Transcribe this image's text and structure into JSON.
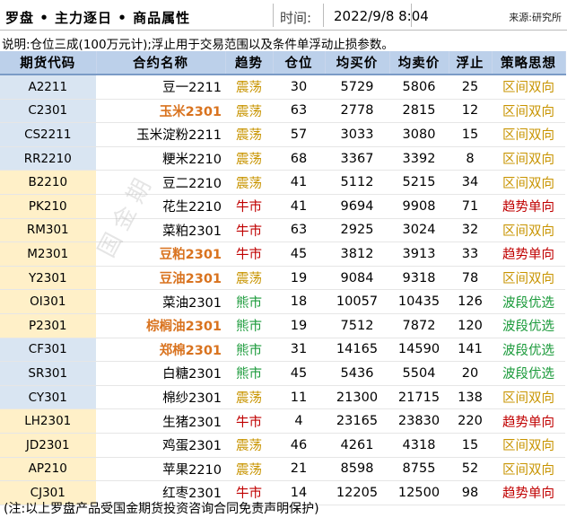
{
  "header": {
    "title": "罗盘 • 主力逐日 • 商品属性",
    "time_label": "时间:",
    "time_value": "2022/9/8 8:04",
    "source": "来源:研究所"
  },
  "note": "说明:仓位三成(100万元计);浮止用于交易范围以及条件单浮动止损参数。",
  "columns": [
    "期货代码",
    "合约名称",
    "趋势",
    "仓位",
    "均买价",
    "均卖价",
    "浮止",
    "策略思想"
  ],
  "rows": [
    {
      "code": "A2211",
      "name": "豆一2211",
      "trend": "震荡",
      "position": "30",
      "buy": "5729",
      "sell": "5806",
      "stop": "25",
      "strategy": "区间双向"
    },
    {
      "code": "C2301",
      "name": "玉米2301",
      "trend": "震荡",
      "position": "63",
      "buy": "2778",
      "sell": "2815",
      "stop": "12",
      "strategy": "区间双向"
    },
    {
      "code": "CS2211",
      "name": "玉米淀粉2211",
      "trend": "震荡",
      "position": "57",
      "buy": "3033",
      "sell": "3080",
      "stop": "15",
      "strategy": "区间双向"
    },
    {
      "code": "RR2210",
      "name": "粳米2210",
      "trend": "震荡",
      "position": "68",
      "buy": "3367",
      "sell": "3392",
      "stop": "8",
      "strategy": "区间双向"
    },
    {
      "code": "B2210",
      "name": "豆二2210",
      "trend": "震荡",
      "position": "41",
      "buy": "5112",
      "sell": "5215",
      "stop": "34",
      "strategy": "区间双向"
    },
    {
      "code": "PK210",
      "name": "花生2210",
      "trend": "牛市",
      "position": "41",
      "buy": "9694",
      "sell": "9908",
      "stop": "71",
      "strategy": "趋势单向"
    },
    {
      "code": "RM301",
      "name": "菜粕2301",
      "trend": "牛市",
      "position": "63",
      "buy": "2925",
      "sell": "3024",
      "stop": "32",
      "strategy": "区间双向"
    },
    {
      "code": "M2301",
      "name": "豆粕2301",
      "trend": "牛市",
      "position": "45",
      "buy": "3812",
      "sell": "3913",
      "stop": "33",
      "strategy": "趋势单向"
    },
    {
      "code": "Y2301",
      "name": "豆油2301",
      "trend": "震荡",
      "position": "19",
      "buy": "9084",
      "sell": "9318",
      "stop": "78",
      "strategy": "区间双向"
    },
    {
      "code": "OI301",
      "name": "菜油2301",
      "trend": "熊市",
      "position": "18",
      "buy": "10057",
      "sell": "10435",
      "stop": "126",
      "strategy": "波段优选"
    },
    {
      "code": "P2301",
      "name": "棕榈油2301",
      "trend": "熊市",
      "position": "19",
      "buy": "7512",
      "sell": "7872",
      "stop": "120",
      "strategy": "波段优选"
    },
    {
      "code": "CF301",
      "name": "郑棉2301",
      "trend": "熊市",
      "position": "31",
      "buy": "14165",
      "sell": "14590",
      "stop": "141",
      "strategy": "波段优选"
    },
    {
      "code": "SR301",
      "name": "白糖2301",
      "trend": "熊市",
      "position": "45",
      "buy": "5436",
      "sell": "5504",
      "stop": "20",
      "strategy": "波段优选"
    },
    {
      "code": "CY301",
      "name": "棉纱2301",
      "trend": "震荡",
      "position": "11",
      "buy": "21300",
      "sell": "21715",
      "stop": "138",
      "strategy": "区间双向"
    },
    {
      "code": "LH2301",
      "name": "生猪2301",
      "trend": "牛市",
      "position": "4",
      "buy": "23165",
      "sell": "23830",
      "stop": "220",
      "strategy": "趋势单向"
    },
    {
      "code": "JD2301",
      "name": "鸡蛋2301",
      "trend": "震荡",
      "position": "46",
      "buy": "4261",
      "sell": "4318",
      "stop": "15",
      "strategy": "区间双向"
    },
    {
      "code": "AP210",
      "name": "苹果2210",
      "trend": "震荡",
      "position": "21",
      "buy": "8598",
      "sell": "8755",
      "stop": "52",
      "strategy": "区间双向"
    },
    {
      "code": "CJ301",
      "name": "红枣2301",
      "trend": "牛市",
      "position": "14",
      "buy": "12205",
      "sell": "12500",
      "stop": "98",
      "strategy": "趋势单向"
    }
  ],
  "watermark": "国金期",
  "footer": "(注:以上罗盘产品受国金期货投资咨询合同免责声明保护)",
  "colors": {
    "header_bg": "#bcd0ea",
    "code_blue": "#d9e5f2",
    "code_yellow": "#fff0c8",
    "highlight_name": "#d9731f",
    "oscillate": "#c89400",
    "bull": "#c00000",
    "bear": "#1a9a3a"
  }
}
